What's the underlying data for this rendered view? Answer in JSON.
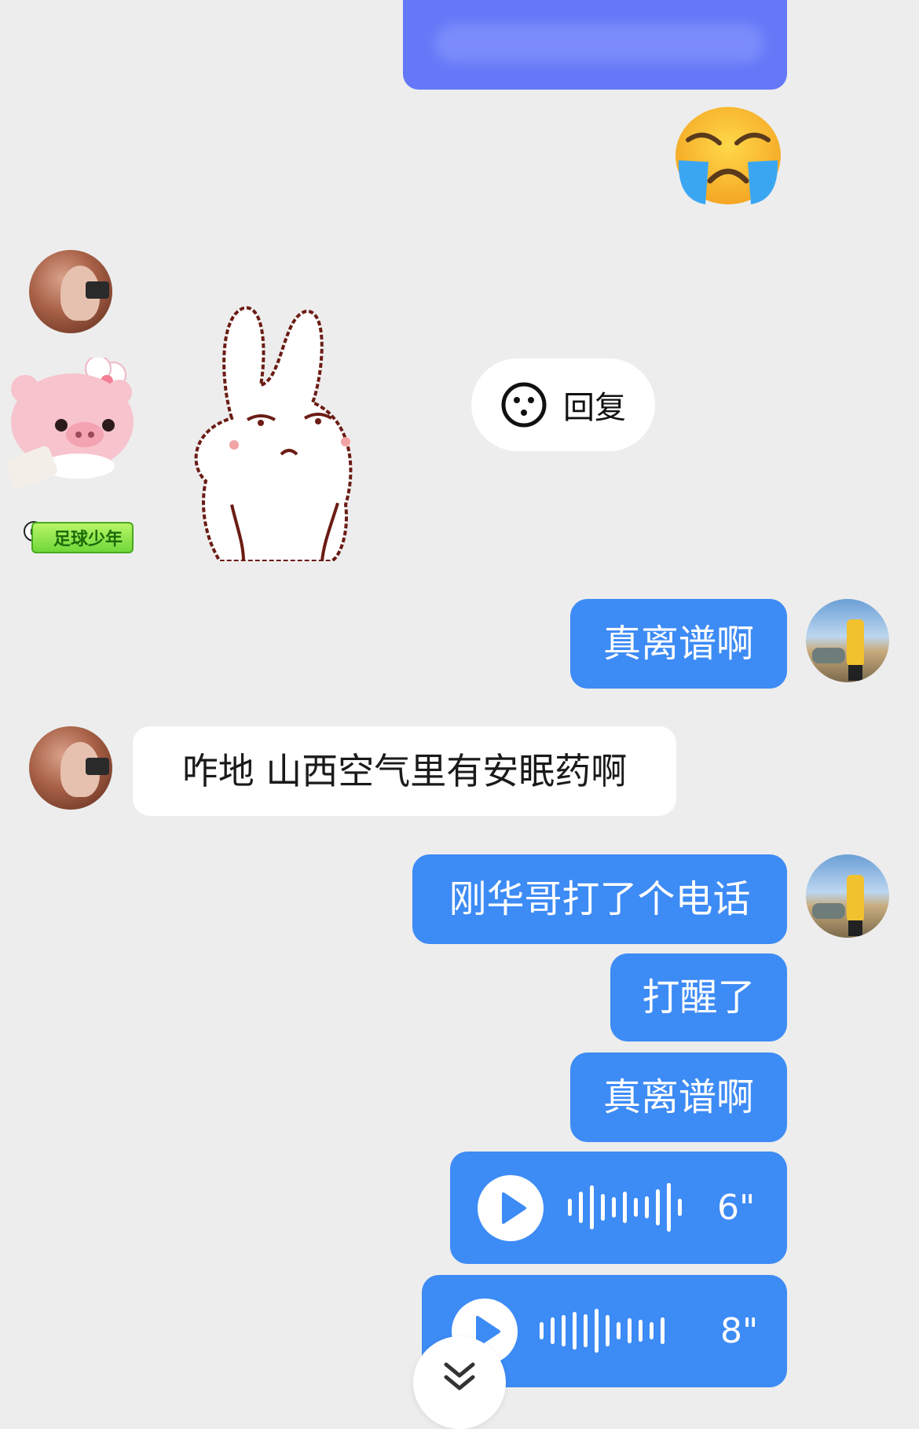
{
  "messages": {
    "reply_label": "回复",
    "badge": "足球少年",
    "m1": "真离谱啊",
    "m2": "咋地 山西空气里有安眠药啊",
    "m3": "刚华哥打了个电话",
    "m4": "打醒了",
    "m5": "真离谱啊",
    "voice1_duration": "6\"",
    "voice2_duration": "8\""
  },
  "colors": {
    "background": "#ededed",
    "my_bubble": "#3d8bf5",
    "blurred_bubble": "#6478f8",
    "other_bubble": "#ffffff"
  },
  "icons": {
    "emoji": "crying-emoji",
    "reaction": "smiley-reaction-icon",
    "scroll": "double-chevron-down-icon",
    "play": "play-icon"
  }
}
